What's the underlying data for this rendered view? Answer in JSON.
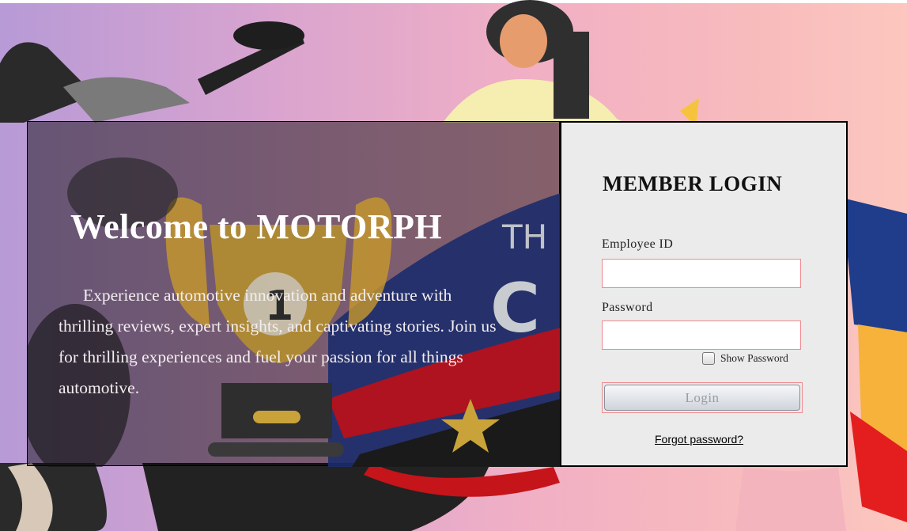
{
  "welcome": {
    "title": "Welcome to MOTORPH",
    "body": "Experience automotive innovation and adventure with thrilling reviews, expert insights, and captivating stories. Join us for thrilling experiences and fuel your passion for all things automotive."
  },
  "login": {
    "title": "MEMBER LOGIN",
    "employee_id_label": "Employee ID",
    "employee_id_value": "",
    "password_label": "Password",
    "password_value": "",
    "show_password_label": "Show Password",
    "show_password_checked": false,
    "login_button_label": "Login",
    "forgot_password_link": "Forgot password?"
  },
  "background": {
    "banner_text_1": "TH",
    "banner_text_2": "C",
    "trophy_badge_number": "1"
  },
  "colors": {
    "login_panel_bg": "#ebebeb",
    "field_border": "#f08a90",
    "welcome_overlay": "rgba(0,0,0,0.45)"
  }
}
